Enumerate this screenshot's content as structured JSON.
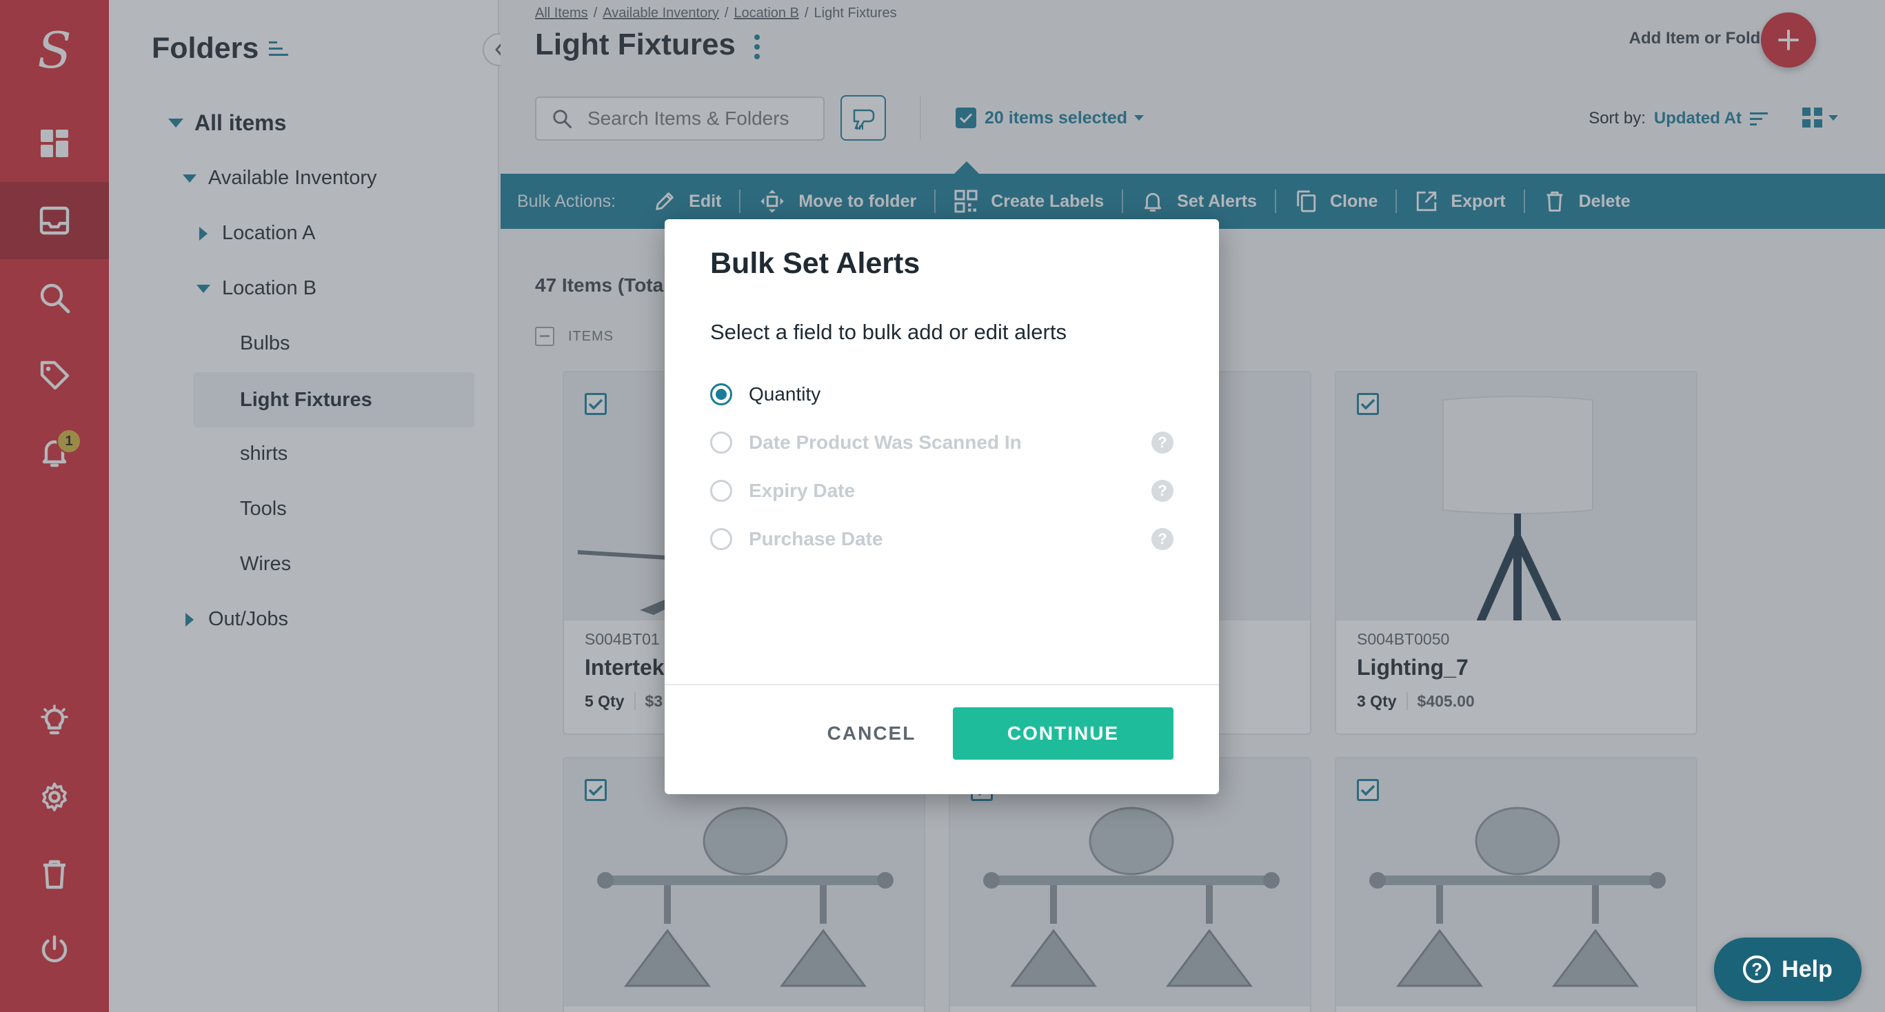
{
  "app": {
    "logo_letter": "S",
    "notification_count": "1"
  },
  "colors": {
    "brand_red": "#d12b35",
    "teal": "#1b7c98",
    "continue_green": "#1fbc9c"
  },
  "sidebar": {
    "icons": [
      "dashboard-icon",
      "inventory-icon",
      "search-icon",
      "tag-icon",
      "bell-icon",
      "lightbulb-icon",
      "gear-icon",
      "trash-icon",
      "power-icon"
    ]
  },
  "folders": {
    "title": "Folders",
    "items": [
      {
        "label": "All items"
      },
      {
        "label": "Available Inventory"
      },
      {
        "label": "Location A"
      },
      {
        "label": "Location B"
      },
      {
        "label": "Bulbs"
      },
      {
        "label": "Light Fixtures"
      },
      {
        "label": "shirts"
      },
      {
        "label": "Tools"
      },
      {
        "label": "Wires"
      },
      {
        "label": "Out/Jobs"
      }
    ]
  },
  "breadcrumb": {
    "items": [
      "All Items",
      "Available Inventory",
      "Location B"
    ],
    "current": "Light Fixtures"
  },
  "header": {
    "title": "Light Fixtures",
    "add_label": "Add Item or Folder",
    "search_placeholder": "Search Items & Folders",
    "selected_label": "20 items selected",
    "sort_label": "Sort by:",
    "sort_value": "Updated At"
  },
  "bulk": {
    "label": "Bulk Actions:",
    "actions": [
      {
        "label": "Edit",
        "icon": "pencil-icon"
      },
      {
        "label": "Move to folder",
        "icon": "move-icon"
      },
      {
        "label": "Create Labels",
        "icon": "qr-icon"
      },
      {
        "label": "Set Alerts",
        "icon": "bell-icon"
      },
      {
        "label": "Clone",
        "icon": "clone-icon"
      },
      {
        "label": "Export",
        "icon": "export-icon"
      },
      {
        "label": "Delete",
        "icon": "trash-icon"
      }
    ]
  },
  "list": {
    "count_label": "47 Items (Tota",
    "header_label": "ITEMS",
    "cards": [
      {
        "sku": "S004BT01",
        "name": "Intertek",
        "qty": "5 Qty",
        "price": "$3"
      },
      {
        "sku": "",
        "name": "",
        "qty": "",
        "price": ""
      },
      {
        "sku": "S004BT0050",
        "name": "Lighting_7",
        "qty": "3 Qty",
        "price": "$405.00"
      }
    ]
  },
  "modal": {
    "title": "Bulk Set Alerts",
    "subtitle": "Select a field to bulk add or edit alerts",
    "options": [
      {
        "label": "Quantity",
        "selected": true,
        "disabled": false
      },
      {
        "label": "Date Product Was Scanned In",
        "selected": false,
        "disabled": true
      },
      {
        "label": "Expiry Date",
        "selected": false,
        "disabled": true
      },
      {
        "label": "Purchase Date",
        "selected": false,
        "disabled": true
      }
    ],
    "help_glyph": "?",
    "cancel_label": "CANCEL",
    "continue_label": "CONTINUE"
  },
  "help": {
    "label": "Help",
    "glyph": "?"
  }
}
